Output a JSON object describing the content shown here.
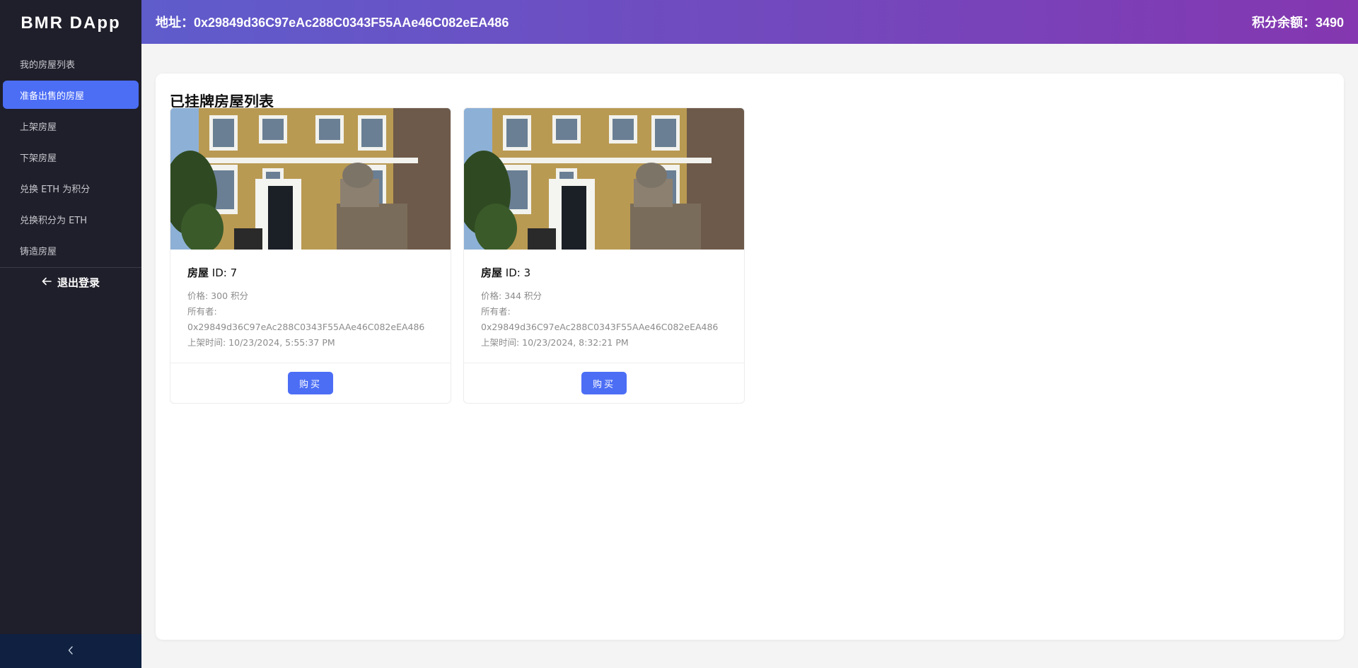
{
  "app": {
    "title": "BMR DApp"
  },
  "sidebar": {
    "items": [
      {
        "label": "我的房屋列表",
        "active": false
      },
      {
        "label": "准备出售的房屋",
        "active": true
      },
      {
        "label": "上架房屋",
        "active": false
      },
      {
        "label": "下架房屋",
        "active": false
      },
      {
        "label": "兑换 ETH 为积分",
        "active": false
      },
      {
        "label": "兑换积分为 ETH",
        "active": false
      },
      {
        "label": "铸造房屋",
        "active": false
      }
    ],
    "logout_label": "退出登录",
    "collapse_icon": "chevron-left-icon"
  },
  "header": {
    "address_label": "地址：",
    "address": "0x29849d36C97eAc288C0343F55AAe46C082eEA486",
    "balance_label": "积分余额：",
    "balance": "3490"
  },
  "main": {
    "title": "已挂牌房屋列表",
    "cards": [
      {
        "title_label": "房屋",
        "title_id": " ID: 7",
        "price": "价格: 300 积分",
        "owner_label": "所有者:",
        "owner": "0x29849d36C97eAc288C0343F55AAe46C082eEA486",
        "listed_time": "上架时间: 10/23/2024, 5:55:37 PM",
        "buy_label": "购买"
      },
      {
        "title_label": "房屋",
        "title_id": " ID: 3",
        "price": "价格: 344 积分",
        "owner_label": "所有者:",
        "owner": "0x29849d36C97eAc288C0343F55AAe46C082eEA486",
        "listed_time": "上架时间: 10/23/2024, 8:32:21 PM",
        "buy_label": "购买"
      }
    ]
  },
  "colors": {
    "sidebar_bg": "#1f1f2b",
    "accent": "#4c6ef5",
    "header_gradient_start": "#5f5ccc",
    "header_gradient_end": "#8437b0",
    "collapse_bg": "#0f2040"
  }
}
